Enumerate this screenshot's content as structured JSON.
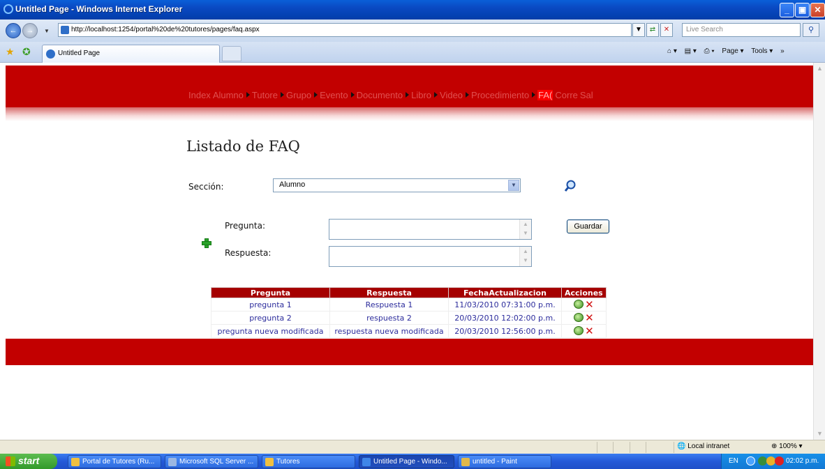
{
  "window": {
    "title": "Untitled Page - Windows Internet Explorer",
    "minimize": "_",
    "maximize": "▣",
    "close": "✕"
  },
  "browser": {
    "address": "http://localhost:1254/portal%20de%20tutores/pages/faq.aspx",
    "search_placeholder": "Live Search",
    "tab_title": "Untitled Page",
    "commands": [
      "Page ▾",
      "Tools ▾"
    ]
  },
  "site": {
    "menu": [
      {
        "label": "Index",
        "submenu": false
      },
      {
        "label": "Alumno",
        "submenu": true
      },
      {
        "label": "Tutore",
        "submenu": true
      },
      {
        "label": "Grupo",
        "submenu": true
      },
      {
        "label": "Evento",
        "submenu": true
      },
      {
        "label": "Documento",
        "submenu": true
      },
      {
        "label": "Libro",
        "submenu": true
      },
      {
        "label": "Video",
        "submenu": true
      },
      {
        "label": "Procedimiento",
        "submenu": true
      },
      {
        "label": "FA(",
        "submenu": false,
        "active": true
      },
      {
        "label": "Corre",
        "submenu": false
      },
      {
        "label": "Sal",
        "submenu": false
      }
    ]
  },
  "page": {
    "title": "Listado de FAQ",
    "seccion_label": "Sección:",
    "seccion_value": "Alumno",
    "pregunta_label": "Pregunta:",
    "respuesta_label": "Respuesta:",
    "guardar_label": "Guardar"
  },
  "grid": {
    "columns": [
      "Pregunta",
      "Respuesta",
      "FechaActualizacion",
      "Acciones"
    ],
    "rows": [
      [
        "pregunta 1",
        "Respuesta 1",
        "11/03/2010 07:31:00 p.m."
      ],
      [
        "pregunta 2",
        "respuesta 2",
        "20/03/2010 12:02:00 p.m."
      ],
      [
        "pregunta nueva modificada",
        "respuesta nueva modificada",
        "20/03/2010 12:56:00 p.m."
      ]
    ]
  },
  "status": {
    "zone": "Local intranet",
    "zoom": "100%"
  },
  "taskbar": {
    "start": "start",
    "tasks": [
      {
        "label": "Portal de Tutores (Ru...",
        "active": false
      },
      {
        "label": "Microsoft SQL Server ...",
        "active": false
      },
      {
        "label": "Tutores",
        "active": false
      },
      {
        "label": "Untitled Page - Windo...",
        "active": true
      },
      {
        "label": "untitled - Paint",
        "active": false
      }
    ],
    "lang": "EN",
    "clock": "02:02 p.m."
  }
}
